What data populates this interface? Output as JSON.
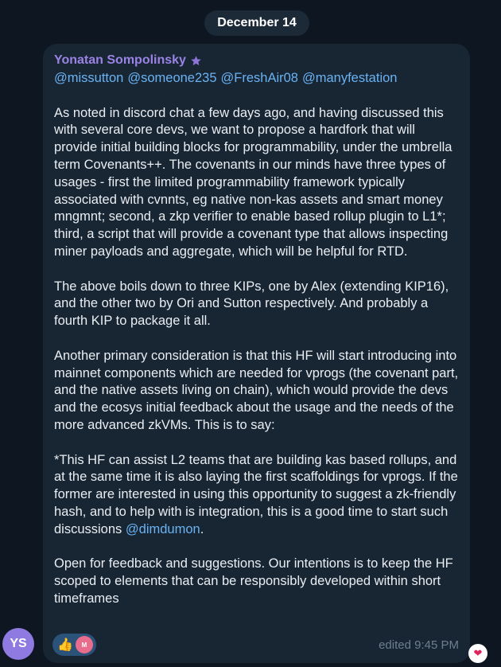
{
  "date_label": "December 14",
  "message": {
    "sender": "Yonatan Sompolinsky",
    "mentions": [
      "@missutton",
      "@someone235",
      "@FreshAir08",
      "@manyfestation"
    ],
    "paragraphs": [
      "As noted in discord chat a few days ago, and having discussed this with several core devs, we want to propose a hardfork that will provide initial building blocks for programmability, under the umbrella term Covenants++. The covenants in our minds have three types of usages - first the limited programmability framework typically associated with cvnnts, eg native non-kas assets and smart money mngmnt; second, a zkp verifier to enable based rollup plugin to L1*; third, a script that will provide a covenant type that allows inspecting miner payloads and aggregate, which will be helpful for RTD.",
      "The above boils down to three KIPs, one by Alex (extending KIP16), and the other two by Ori and Sutton respectively. And probably a fourth KIP to package it all.",
      "Another primary consideration is that this HF will start introducing into mainnet components which are needed for vprogs (the covenant part, and the native assets living on chain), which would provide the devs and the ecosys initial feedback about the usage and the needs of the more advanced zkVMs. This is to say:"
    ],
    "para4_text": "*This HF can assist L2 teams that are building kas based rollups, and at the same time it is also laying the first scaffoldings for vprogs. If the former are interested in using this opportunity to suggest a zk-friendly hash, and to help with is integration, this is a good time to start such discussions",
    "para4_link": "@dimdumon",
    "para4_end": ".",
    "para5": "Open for feedback and suggestions. Our intentions is to keep the HF scoped to elements that can be responsibly developed within short timeframes",
    "edited_time": "edited 9:45 PM",
    "reaction_emoji": "👍",
    "reaction_avatar_initial": "M",
    "heart": "❤"
  },
  "avatar_initials": "YS",
  "colors": {
    "background": "#0e1621",
    "bubble": "#182533",
    "sender_name": "#9b83e6",
    "link": "#6ab3f3",
    "reaction_pill": "#2b5278"
  }
}
